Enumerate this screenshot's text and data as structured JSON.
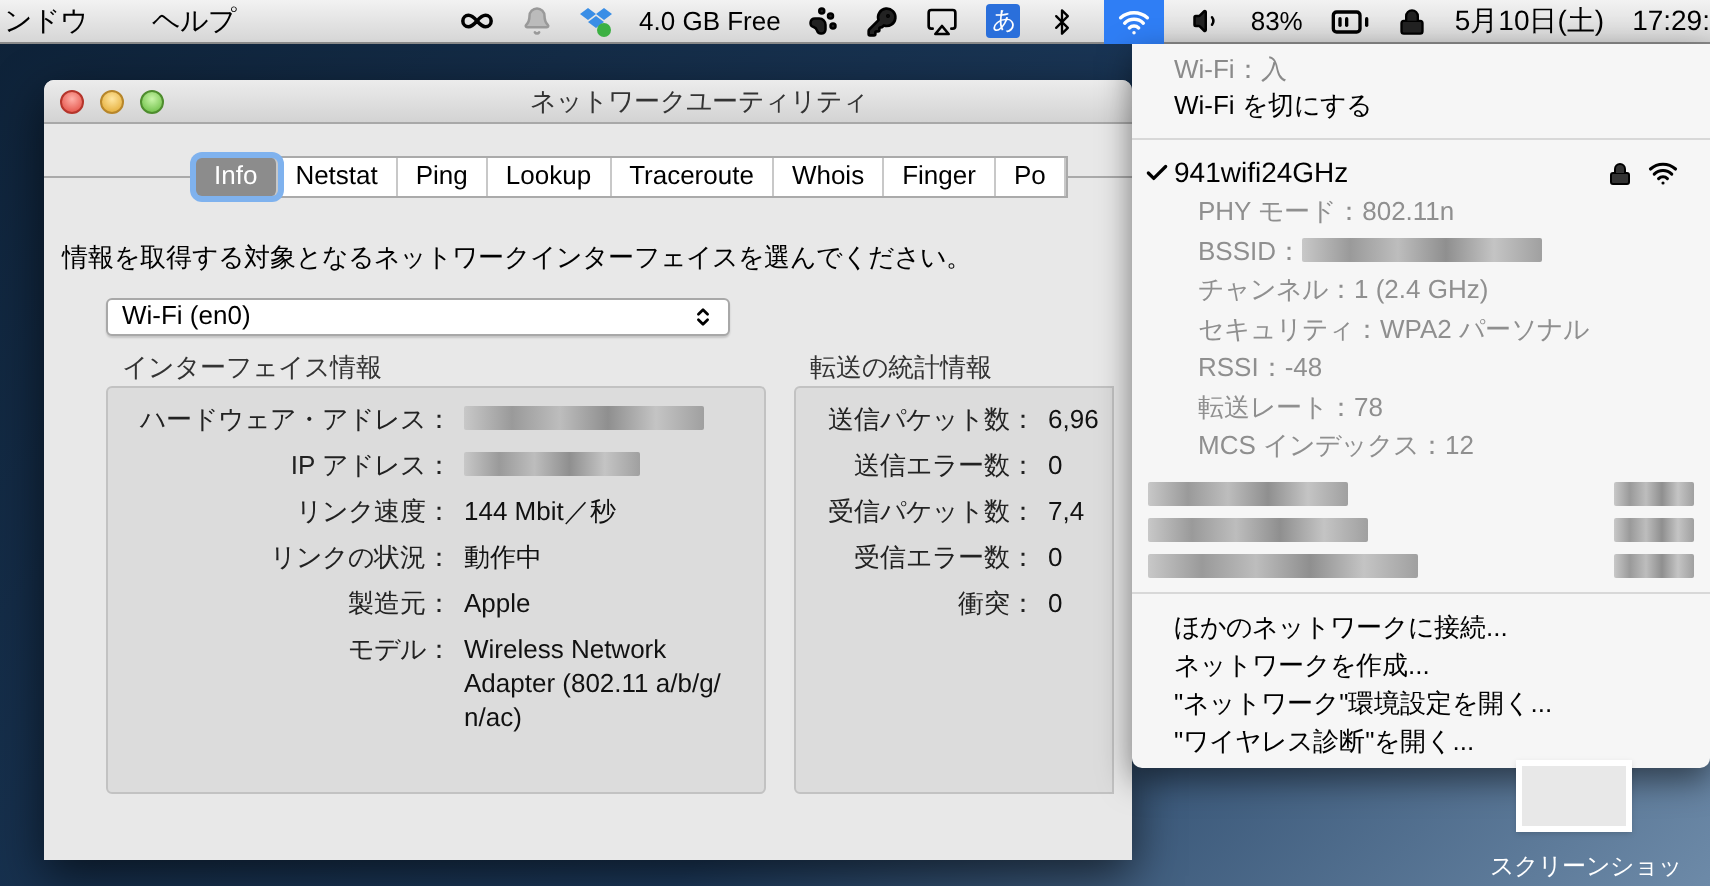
{
  "menubar": {
    "menus": [
      "ンドウ",
      "ヘルプ"
    ],
    "storage_status": "4.0 GB Free",
    "input_mode": "あ",
    "wifi_selected": true,
    "battery": "83%",
    "date": "5月10日(土)",
    "time": "17:29:"
  },
  "window": {
    "title": "ネットワークユーティリティ",
    "tabs": [
      {
        "label": "Info",
        "selected": true
      },
      {
        "label": "Netstat",
        "selected": false
      },
      {
        "label": "Ping",
        "selected": false
      },
      {
        "label": "Lookup",
        "selected": false
      },
      {
        "label": "Traceroute",
        "selected": false
      },
      {
        "label": "Whois",
        "selected": false
      },
      {
        "label": "Finger",
        "selected": false
      },
      {
        "label": "Po",
        "selected": false
      }
    ],
    "prompt": "情報を取得する対象となるネットワークインターフェイスを選んでください。",
    "interface_select": {
      "value": "Wi-Fi (en0)"
    },
    "interface_info": {
      "title": "インターフェイス情報",
      "rows": [
        {
          "label": "ハードウェア・アドレス：",
          "kind": "redacted"
        },
        {
          "label": "IP アドレス：",
          "kind": "redacted"
        },
        {
          "label": "リンク速度：",
          "kind": "text",
          "value": "144 Mbit／秒"
        },
        {
          "label": "リンクの状況：",
          "kind": "text",
          "value": "動作中"
        },
        {
          "label": "製造元：",
          "kind": "text",
          "value": "Apple"
        },
        {
          "label": "モデル：",
          "kind": "text",
          "value": "Wireless Network Adapter (802.11 a/b/g/ n/ac)"
        }
      ]
    },
    "transfer_stats": {
      "title": "転送の統計情報",
      "rows": [
        {
          "label": "送信パケット数：",
          "value": "6,96"
        },
        {
          "label": "送信エラー数：",
          "value": "0"
        },
        {
          "label": "受信パケット数：",
          "value": "7,4"
        },
        {
          "label": "受信エラー数：",
          "value": "0"
        },
        {
          "label": "衝突：",
          "value": "0"
        }
      ]
    }
  },
  "wifi_menu": {
    "status": "Wi-Fi：入",
    "toggle": "Wi-Fi を切にする",
    "network": {
      "name": "941wifi24GHz",
      "checked": true,
      "locked": true
    },
    "details": [
      {
        "text": "PHY モード：802.11n",
        "redacted": false
      },
      {
        "text": "BSSID：",
        "redacted": true
      },
      {
        "text": "チャンネル：1 (2.4 GHz)",
        "redacted": false
      },
      {
        "text": "セキュリティ：WPA2 パーソナル",
        "redacted": false
      },
      {
        "text": "RSSI：-48",
        "redacted": false
      },
      {
        "text": "転送レート：78",
        "redacted": false
      },
      {
        "text": "MCS インデックス：12",
        "redacted": false
      }
    ],
    "actions": [
      "ほかのネットワークに接続...",
      "ネットワークを作成...",
      "\"ネットワーク\"環境設定を開く...",
      "\"ワイヤレス診断\"を開く..."
    ]
  },
  "desktop": {
    "file_label": "スクリーンショッ"
  }
}
